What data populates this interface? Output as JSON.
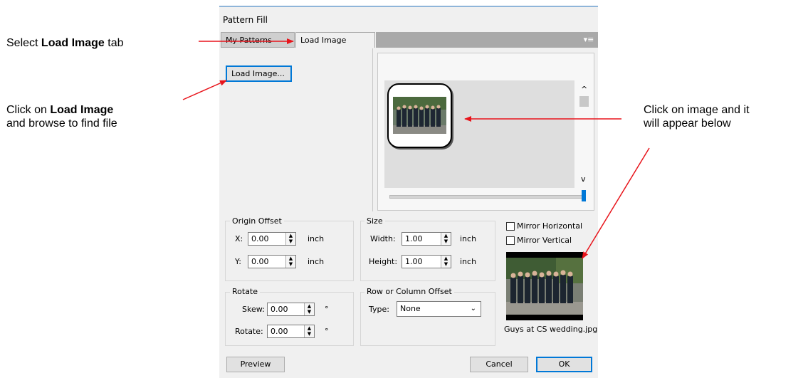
{
  "dialog": {
    "title": "Pattern Fill",
    "tabs": [
      "My Patterns",
      "Load Image"
    ],
    "menu_icon": "list-menu-icon",
    "load_button": "Load Image...",
    "origin_offset": {
      "legend": "Origin Offset",
      "x_label": "X:",
      "x_value": "0.00",
      "x_unit": "inch",
      "y_label": "Y:",
      "y_value": "0.00",
      "y_unit": "inch"
    },
    "size": {
      "legend": "Size",
      "width_label": "Width:",
      "width_value": "1.00",
      "width_unit": "inch",
      "height_label": "Height:",
      "height_value": "1.00",
      "height_unit": "inch"
    },
    "mirror_horizontal": "Mirror Horizontal",
    "mirror_vertical": "Mirror Vertical",
    "rotate": {
      "legend": "Rotate",
      "skew_label": "Skew:",
      "skew_value": "0.00",
      "rotate_label": "Rotate:",
      "rotate_value": "0.00",
      "degree": "°"
    },
    "row_col_offset": {
      "legend": "Row or Column Offset",
      "type_label": "Type:",
      "type_value": "None"
    },
    "filename": "Guys at CS wedding.jpg",
    "preview_button": "Preview",
    "cancel_button": "Cancel",
    "ok_button": "OK"
  },
  "annotations": {
    "a1_pre": "Select ",
    "a1_bold": "Load Image",
    "a1_post": " tab",
    "a2_pre": "Click on ",
    "a2_bold": "Load Image",
    "a2_line2": "and browse to find file",
    "a3_line1": "Click on image and it",
    "a3_line2": "will appear below"
  },
  "colors": {
    "arrow": "#e8141b",
    "accent": "#0078d7"
  }
}
